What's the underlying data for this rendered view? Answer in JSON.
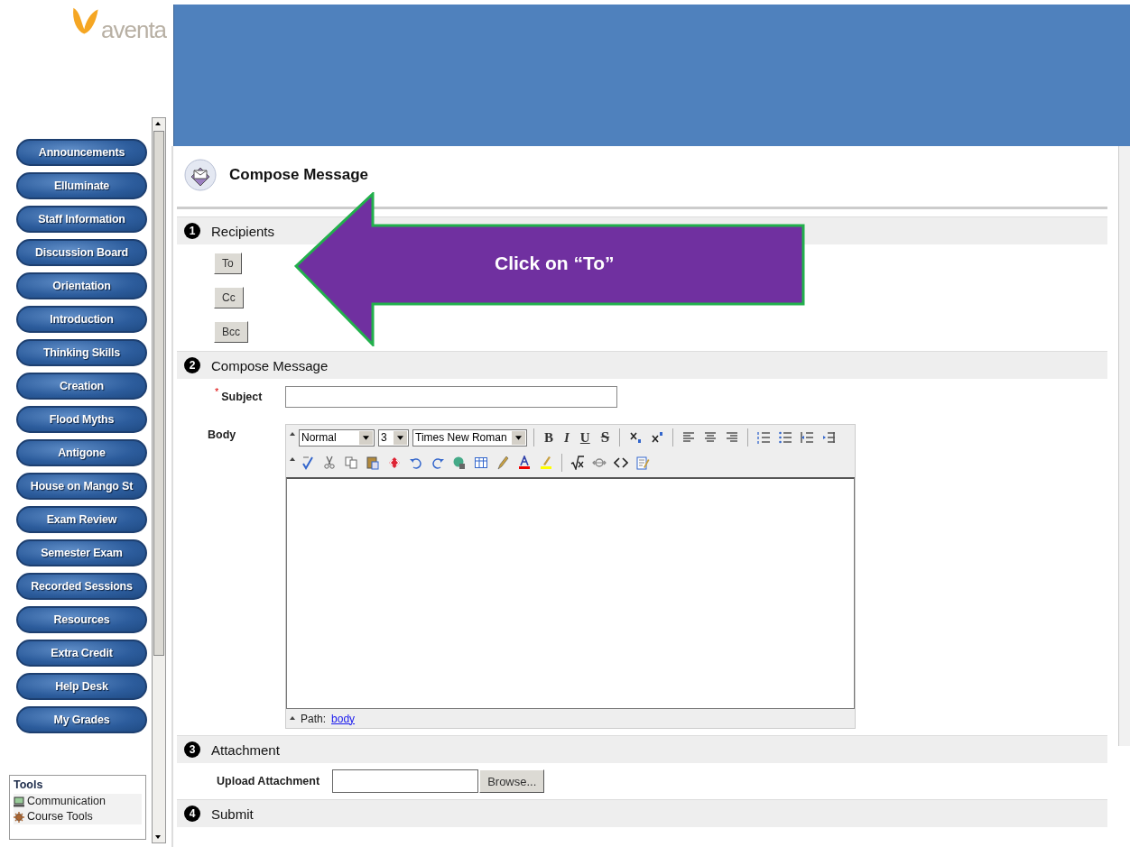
{
  "logo": {
    "text": "aventa"
  },
  "nav": [
    {
      "label": "Announcements"
    },
    {
      "label": "Elluminate"
    },
    {
      "label": "Staff Information"
    },
    {
      "label": "Discussion Board"
    },
    {
      "label": "Orientation"
    },
    {
      "label": "Introduction"
    },
    {
      "label": "Thinking Skills"
    },
    {
      "label": "Creation"
    },
    {
      "label": "Flood Myths"
    },
    {
      "label": "Antigone"
    },
    {
      "label": "House on Mango St"
    },
    {
      "label": "Exam Review"
    },
    {
      "label": "Semester Exam"
    },
    {
      "label": "Recorded Sessions"
    },
    {
      "label": "Resources"
    },
    {
      "label": "Extra Credit"
    },
    {
      "label": "Help Desk"
    },
    {
      "label": "My Grades"
    }
  ],
  "tools": {
    "title": "Tools",
    "items": [
      {
        "label": "Communication",
        "kind": "monitor"
      },
      {
        "label": "Course Tools",
        "kind": "gear"
      }
    ]
  },
  "page": {
    "title": "Compose Message"
  },
  "sections": [
    {
      "kind": "recipients",
      "number": "1",
      "title": "Recipients",
      "buttons": [
        "To",
        "Cc",
        "Bcc"
      ]
    },
    {
      "kind": "compose",
      "number": "2",
      "title": "Compose Message",
      "required_mark": "*",
      "subject_label": "Subject",
      "body_label": "Body",
      "format": "Normal",
      "size": "3",
      "font": "Times New Roman",
      "style_buttons": [
        "B",
        "I",
        "U",
        "S"
      ],
      "path_label": "Path:",
      "path_link": "body"
    },
    {
      "kind": "attachment",
      "number": "3",
      "title": "Attachment",
      "upload_label": "Upload Attachment",
      "browse": "Browse..."
    },
    {
      "kind": "submit",
      "number": "4",
      "title": "Submit"
    }
  ],
  "callout": {
    "text": "Click on “To”"
  }
}
